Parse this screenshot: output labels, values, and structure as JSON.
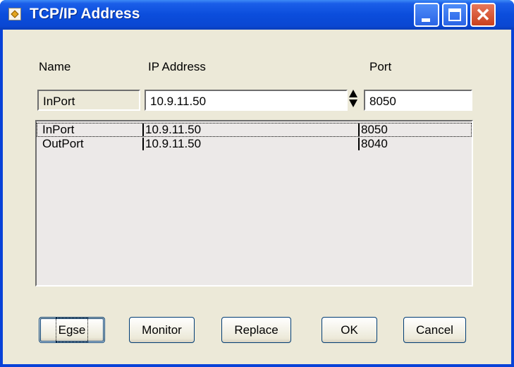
{
  "window": {
    "title": "TCP/IP Address"
  },
  "labels": {
    "name": "Name",
    "ip": "IP Address",
    "port": "Port"
  },
  "inputs": {
    "name_value": "InPort",
    "ip_value": "10.9.11.50",
    "port_value": "8050"
  },
  "list": {
    "rows": [
      {
        "name": "InPort",
        "ip": "10.9.11.50",
        "port": "8050"
      },
      {
        "name": "OutPort",
        "ip": "10.9.11.50",
        "port": "8040"
      }
    ]
  },
  "buttons": {
    "erase": "Egse",
    "monitor": "Monitor",
    "replace": "Replace",
    "ok": "OK",
    "cancel": "Cancel"
  }
}
